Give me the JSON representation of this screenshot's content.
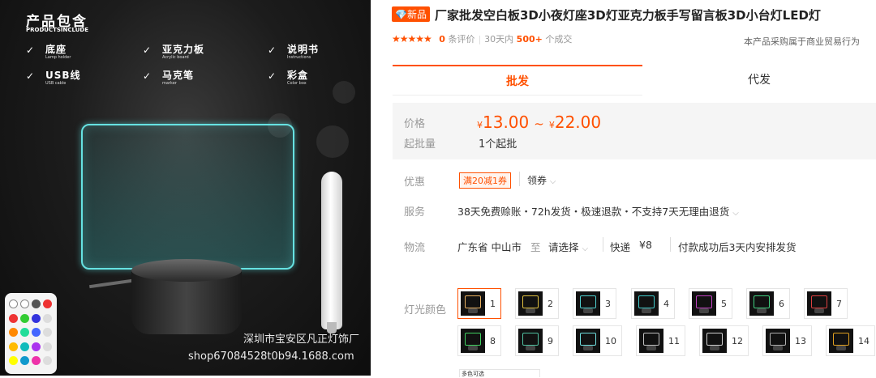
{
  "photo": {
    "title": "产品包含",
    "subtitle": "PRODUCTSINCLUDE",
    "items": [
      {
        "name": "底座",
        "en": "Lamp holder"
      },
      {
        "name": "亚克力板",
        "en": "Acrylic board"
      },
      {
        "name": "说明书",
        "en": "Instructions"
      },
      {
        "name": "USB线",
        "en": "USB cable"
      },
      {
        "name": "马克笔",
        "en": "marker"
      },
      {
        "name": "彩盒",
        "en": "Color box"
      }
    ],
    "check_glyph": "✓",
    "watermark_company": "深圳市宝安区凡正灯饰厂",
    "watermark_shop": "shop67084528t0b94.1688.com",
    "board_color": "#66e2e2"
  },
  "header": {
    "badge_label": "新品",
    "title": "厂家批发空白板3D小夜灯座3D灯亚克力板手写留言板3D小台灯LED灯"
  },
  "rating": {
    "stars": "★★★★★",
    "review_count": "0",
    "review_label": "条评价",
    "period": "30天内",
    "deals": "500+",
    "deals_label": "个成交",
    "trade_note": "本产品采购属于商业贸易行为"
  },
  "tabs": [
    {
      "label": "批发",
      "active": true
    },
    {
      "label": "代发",
      "active": false
    }
  ],
  "pricing": {
    "price_label": "价格",
    "currency": "¥",
    "price_min": "13.00",
    "range_sep": "~",
    "price_max": "22.00",
    "moq_label": "起批量",
    "moq_value": "1个起批"
  },
  "offers": {
    "label": "优惠",
    "coupon": "满20减1券",
    "claim": "领券"
  },
  "service": {
    "label": "服务",
    "value": "38天免费赊账・72h发货・极速退款・不支持7天无理由退货"
  },
  "logistics": {
    "label": "物流",
    "from": "广东省 中山市",
    "to_word": "至",
    "select": "请选择",
    "express": "快递",
    "fee": "¥8",
    "ship_note": "付款成功后3天内安排发货"
  },
  "options": {
    "label": "灯光颜色",
    "swatches": [
      "1",
      "2",
      "3",
      "4",
      "5",
      "6",
      "7",
      "8",
      "9",
      "10",
      "11",
      "12",
      "13",
      "14"
    ],
    "selected": "1",
    "next_label": "多色可选"
  },
  "colors": {
    "accent": "#ff5000",
    "muted": "#999999",
    "price_bg": "#f5f5f5"
  }
}
